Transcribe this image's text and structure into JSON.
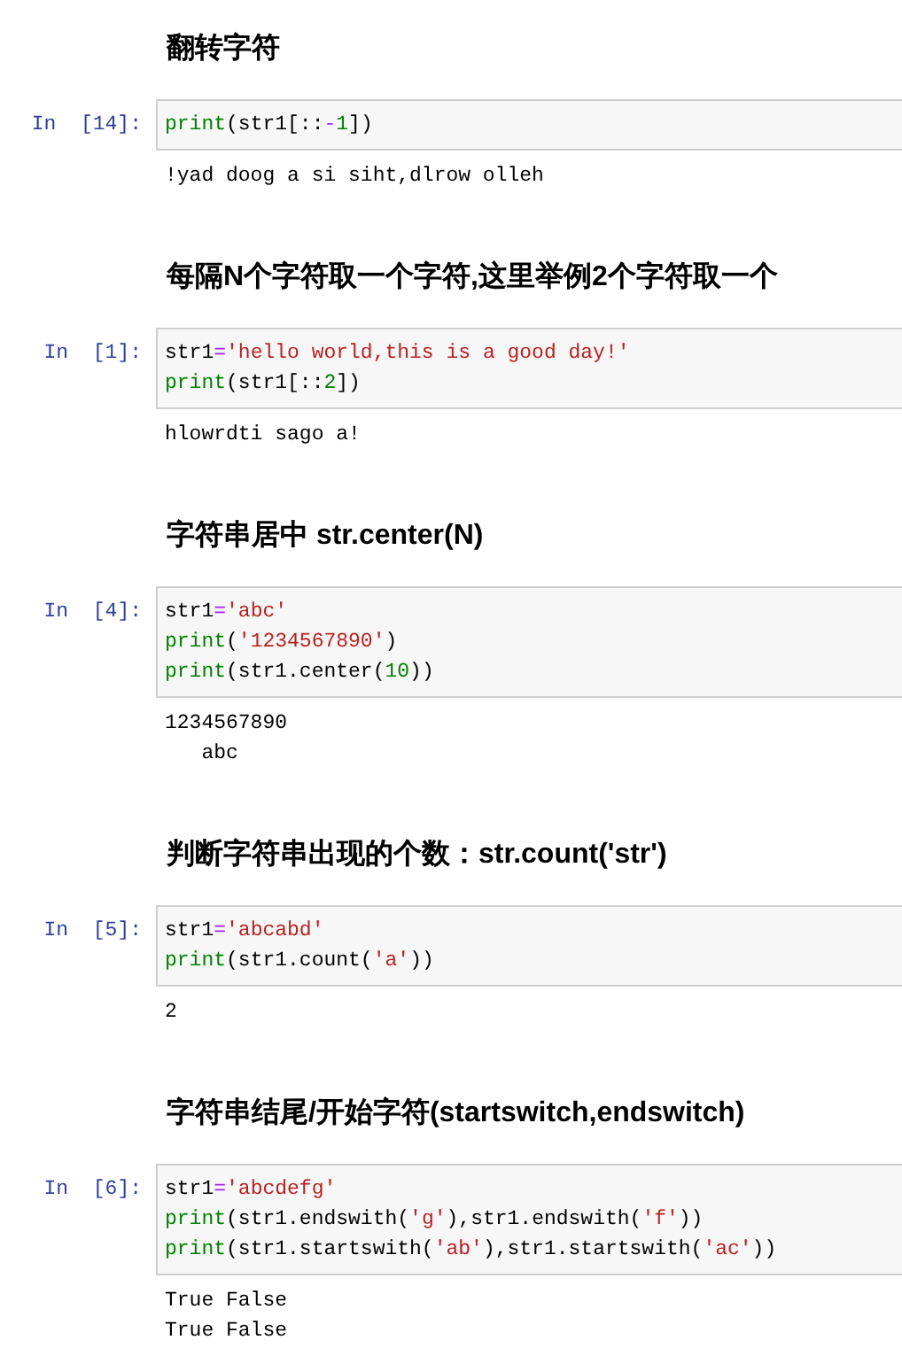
{
  "cells": [
    {
      "kind": "heading",
      "text": "翻转字符"
    },
    {
      "kind": "code",
      "prompt": "In  [14]:",
      "lines": [
        [
          {
            "text": "print",
            "kind": "builtin"
          },
          {
            "text": "(str1[::",
            "kind": "plain"
          },
          {
            "text": "-",
            "kind": "operator"
          },
          {
            "text": "1",
            "kind": "number"
          },
          {
            "text": "])",
            "kind": "plain"
          }
        ]
      ],
      "output": [
        "!yad doog a si siht,dlrow olleh"
      ]
    },
    {
      "kind": "heading",
      "text": "每隔N个字符取一个字符,这里举例2个字符取一个"
    },
    {
      "kind": "code",
      "prompt": "In  [1]:",
      "lines": [
        [
          {
            "text": "str1",
            "kind": "plain"
          },
          {
            "text": "=",
            "kind": "operator"
          },
          {
            "text": "'hello world,this is a good day!'",
            "kind": "string"
          }
        ],
        [
          {
            "text": "print",
            "kind": "builtin"
          },
          {
            "text": "(str1[::",
            "kind": "plain"
          },
          {
            "text": "2",
            "kind": "number"
          },
          {
            "text": "])",
            "kind": "plain"
          }
        ]
      ],
      "output": [
        "hlowrdti sago a!"
      ]
    },
    {
      "kind": "heading",
      "text": "字符串居中 str.center(N)"
    },
    {
      "kind": "code",
      "prompt": "In  [4]:",
      "lines": [
        [
          {
            "text": "str1",
            "kind": "plain"
          },
          {
            "text": "=",
            "kind": "operator"
          },
          {
            "text": "'abc'",
            "kind": "string"
          }
        ],
        [
          {
            "text": "print",
            "kind": "builtin"
          },
          {
            "text": "(",
            "kind": "plain"
          },
          {
            "text": "'1234567890'",
            "kind": "string"
          },
          {
            "text": ")",
            "kind": "plain"
          }
        ],
        [
          {
            "text": "print",
            "kind": "builtin"
          },
          {
            "text": "(str1.center(",
            "kind": "plain"
          },
          {
            "text": "10",
            "kind": "number"
          },
          {
            "text": "))",
            "kind": "plain"
          }
        ]
      ],
      "output": [
        "1234567890",
        "   abc"
      ]
    },
    {
      "kind": "heading",
      "text": "判断字符串出现的个数：str.count('str')"
    },
    {
      "kind": "code",
      "prompt": "In  [5]:",
      "lines": [
        [
          {
            "text": "str1",
            "kind": "plain"
          },
          {
            "text": "=",
            "kind": "operator"
          },
          {
            "text": "'abcabd'",
            "kind": "string"
          }
        ],
        [
          {
            "text": "print",
            "kind": "builtin"
          },
          {
            "text": "(str1.count(",
            "kind": "plain"
          },
          {
            "text": "'a'",
            "kind": "string"
          },
          {
            "text": "))",
            "kind": "plain"
          }
        ]
      ],
      "output": [
        "2"
      ]
    },
    {
      "kind": "heading",
      "text": "字符串结尾/开始字符(startswitch,endswitch)"
    },
    {
      "kind": "code",
      "prompt": "In  [6]:",
      "lines": [
        [
          {
            "text": "str1",
            "kind": "plain"
          },
          {
            "text": "=",
            "kind": "operator"
          },
          {
            "text": "'abcdefg'",
            "kind": "string"
          }
        ],
        [
          {
            "text": "print",
            "kind": "builtin"
          },
          {
            "text": "(str1.endswith(",
            "kind": "plain"
          },
          {
            "text": "'g'",
            "kind": "string"
          },
          {
            "text": "),str1.endswith(",
            "kind": "plain"
          },
          {
            "text": "'f'",
            "kind": "string"
          },
          {
            "text": "))",
            "kind": "plain"
          }
        ],
        [
          {
            "text": "print",
            "kind": "builtin"
          },
          {
            "text": "(str1.startswith(",
            "kind": "plain"
          },
          {
            "text": "'ab'",
            "kind": "string"
          },
          {
            "text": "),str1.startswith(",
            "kind": "plain"
          },
          {
            "text": "'ac'",
            "kind": "string"
          },
          {
            "text": "))",
            "kind": "plain"
          }
        ]
      ],
      "output": [
        "True False",
        "True False"
      ]
    }
  ]
}
